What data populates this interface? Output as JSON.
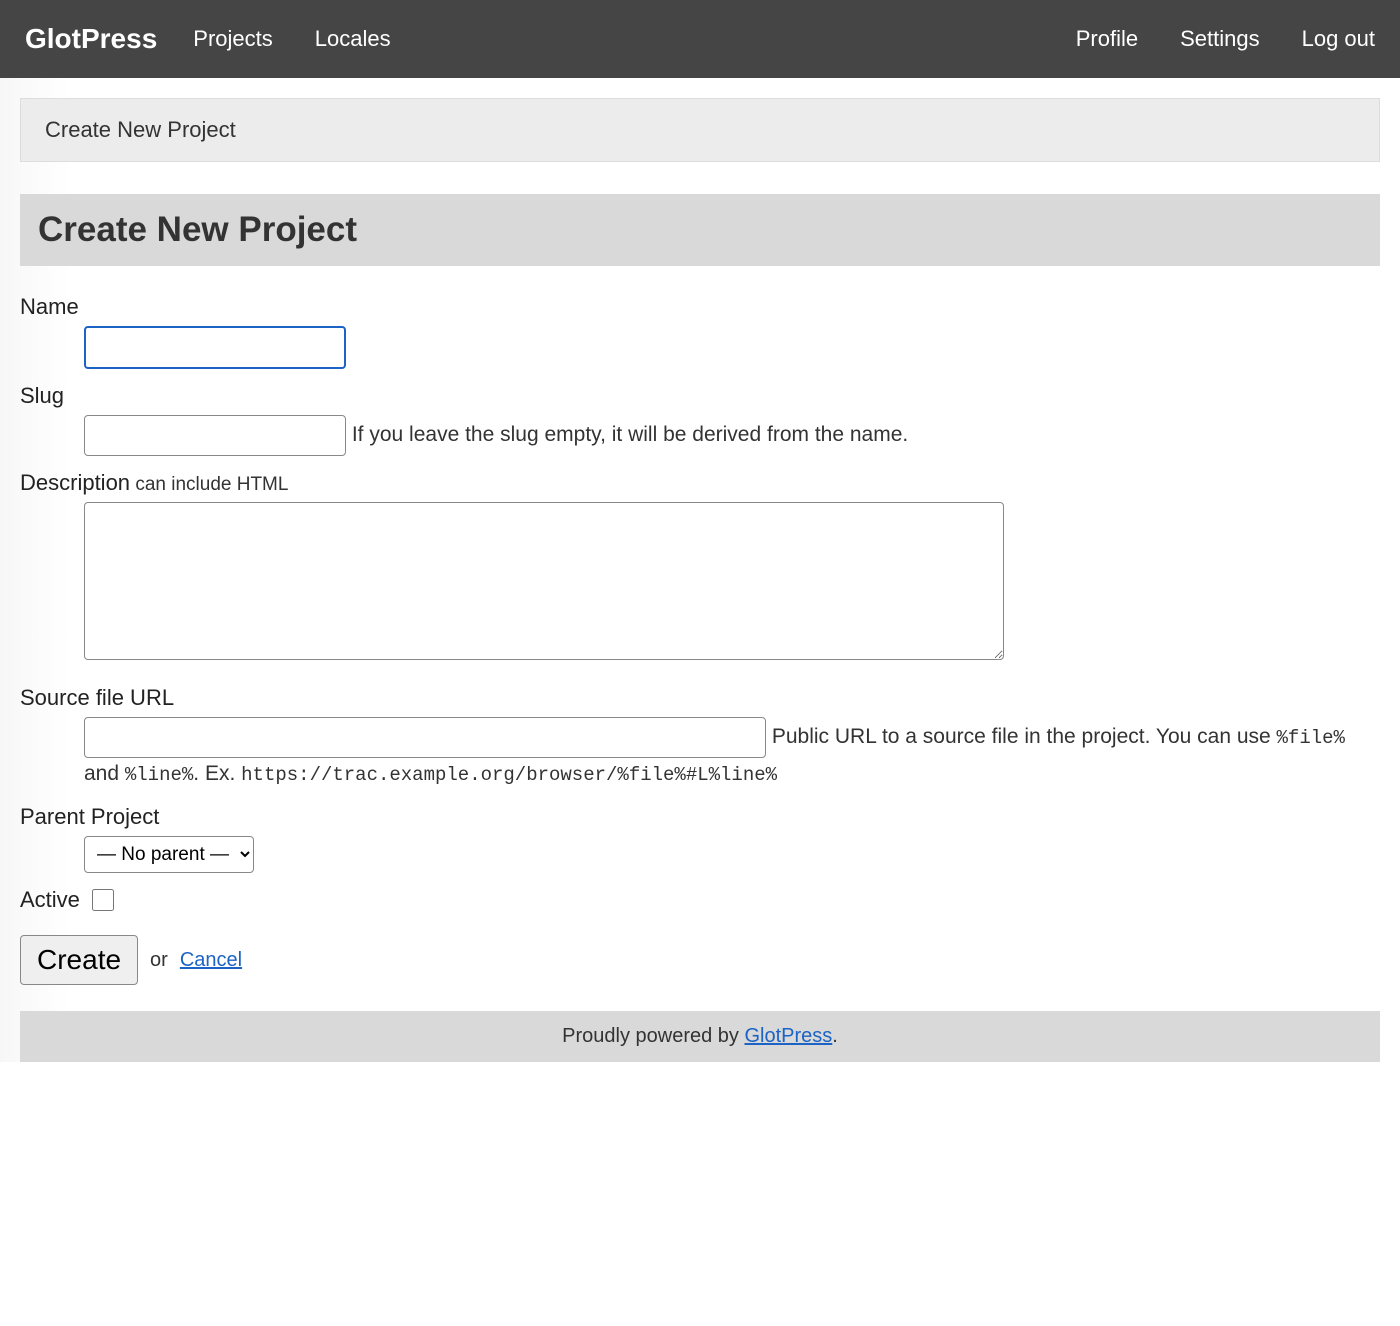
{
  "header": {
    "brand": "GlotPress",
    "nav_left": {
      "projects": "Projects",
      "locales": "Locales"
    },
    "nav_right": {
      "profile": "Profile",
      "settings": "Settings",
      "logout": "Log out"
    }
  },
  "breadcrumb": "Create New Project",
  "page_title": "Create New Project",
  "form": {
    "name": {
      "label": "Name",
      "value": ""
    },
    "slug": {
      "label": "Slug",
      "value": "",
      "hint": "If you leave the slug empty, it will be derived from the name."
    },
    "description": {
      "label": "Description",
      "hint_inline": " can include HTML",
      "value": ""
    },
    "source_url": {
      "label": "Source file URL",
      "value": "",
      "hint_pre": "Public URL to a source file in the project. You can use ",
      "token1": "%file%",
      "hint_mid1": " and ",
      "token2": "%line%",
      "hint_mid2": ". Ex. ",
      "example": "https://trac.example.org/browser/%file%#L%line%"
    },
    "parent": {
      "label": "Parent Project",
      "selected": "— No parent —"
    },
    "active": {
      "label": "Active",
      "checked": false
    }
  },
  "actions": {
    "create": "Create",
    "or": "or",
    "cancel": "Cancel"
  },
  "footer": {
    "text": "Proudly powered by ",
    "link": "GlotPress",
    "suffix": "."
  }
}
